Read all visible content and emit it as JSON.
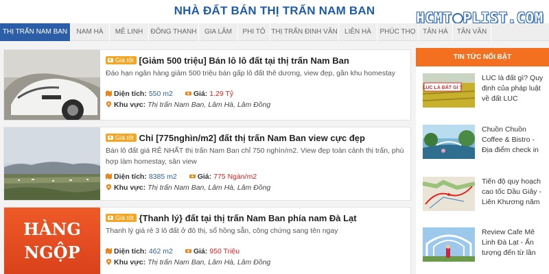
{
  "header": {
    "title": "NHÀ ĐẤT BÁN THỊ TRẤN NAM BAN",
    "logo_text": "HCMTOPLIST.COM"
  },
  "tabs": [
    {
      "label": "THỊ TRẤN NAM BAN",
      "active": true
    },
    {
      "label": "NAM HÀ"
    },
    {
      "label": "MÊ LINH"
    },
    {
      "label": "ĐÔNG THANH"
    },
    {
      "label": "GIA LÂM"
    },
    {
      "label": "PHI TÔ"
    },
    {
      "label": "THỊ TRẤN ĐINH VĂN"
    },
    {
      "label": "LIÊN HÀ"
    },
    {
      "label": "PHÚC THỌ"
    },
    {
      "label": "TÂN HÀ"
    },
    {
      "label": "TÂN VĂN"
    }
  ],
  "listings": [
    {
      "badge": "Giá tốt",
      "title": "[Giảm 500 triệu] Bán lô lô đất tại thị trấn Nam Ban",
      "description": "Đáo hạn ngân hàng giảm 500 triệu bán gấp lô đất thê dương, view đẹp, gần khu homestay",
      "area_label": "Diện tích:",
      "area": "550 m2",
      "price_label": "Giá:",
      "price": "1.29 Tỷ",
      "location_label": "Khu vực:",
      "location": "Thị trấn Nam Ban, Lâm Hà, Lâm Đồng"
    },
    {
      "badge": "Giá tốt",
      "title": "Chỉ [775nghìn/m2] đất thị trấn Nam Ban view cực đẹp",
      "description": "Bán lô đất giá RẺ NHẤT thị trấn Nam Ban chỉ 750 nghìn/m2. View đẹp toàn cảnh thị trấn, phù hợp làm homestay, sân view",
      "area_label": "Diện tích:",
      "area": "8385 m2",
      "price_label": "Giá:",
      "price": "775 Ngàn/m2",
      "location_label": "Khu vực:",
      "location": "Thị trấn Nam Ban, Lâm Hà, Lâm Đồng"
    },
    {
      "badge": "Giá tốt",
      "title": "{Thanh lý} đất tại thị trấn Nam Ban phía nam Đà Lạt",
      "description": "Thanh lý giá rẻ 3 lô đất ở đô thị, sổ hồng sẵn, công chứng sang tên ngay",
      "area_label": "Diện tích:",
      "area": "462 m2",
      "price_label": "Giá:",
      "price": "950 Triệu",
      "location_label": "Khu vực:",
      "location": "Thị trấn Nam Ban, Lâm Hà, Lâm Đồng",
      "thumb_text_1": "HÀNG",
      "thumb_text_2": "NGỘP"
    }
  ],
  "sidebar": {
    "heading": "TIN TỨC NỔI BẬT",
    "news": [
      {
        "title": "LUC là đất gì? Quy định của pháp luật về đất LUC",
        "thumb_text": "LUC LÀ ĐẤT GÌ ?"
      },
      {
        "title": "Chuồn Chuồn Coffee & Bistro - Địa điểm check in"
      },
      {
        "title": "Tiến độ quy hoạch cao tốc Dầu Giây - Liên Khương năm"
      },
      {
        "title": "Review Cafe Mê Linh Đà Lạt - Ấn tượng đến từ lần"
      }
    ]
  },
  "colors": {
    "primary": "#2b5ea6",
    "accent": "#f37021",
    "badge": "#f4a623",
    "price": "#e02020"
  }
}
